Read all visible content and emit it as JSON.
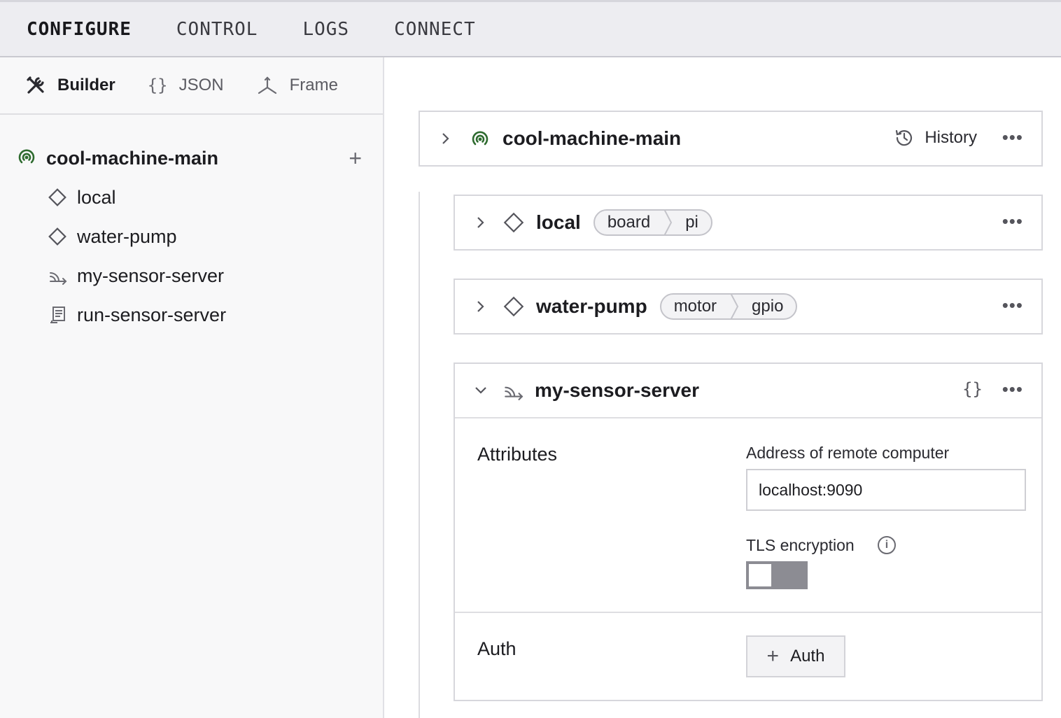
{
  "topnav": {
    "tabs": [
      {
        "label": "CONFIGURE",
        "active": true
      },
      {
        "label": "CONTROL",
        "active": false
      },
      {
        "label": "LOGS",
        "active": false
      },
      {
        "label": "CONNECT",
        "active": false
      }
    ]
  },
  "sidebar": {
    "subtabs": [
      {
        "label": "Builder",
        "icon": "tools-icon",
        "active": true
      },
      {
        "label": "JSON",
        "icon": "braces-icon",
        "active": false
      },
      {
        "label": "Frame",
        "icon": "axes-icon",
        "active": false
      }
    ],
    "tree": {
      "root": {
        "label": "cool-machine-main",
        "icon": "machine-signal-icon",
        "add_label": "+"
      },
      "items": [
        {
          "label": "local",
          "icon": "diamond-icon"
        },
        {
          "label": "water-pump",
          "icon": "diamond-icon"
        },
        {
          "label": "my-sensor-server",
          "icon": "remote-icon"
        },
        {
          "label": "run-sensor-server",
          "icon": "process-icon"
        }
      ]
    }
  },
  "main": {
    "machine_card": {
      "title": "cool-machine-main",
      "history_label": "History",
      "more": "•••"
    },
    "components": [
      {
        "title": "local",
        "type": "board",
        "model": "pi",
        "more": "•••"
      },
      {
        "title": "water-pump",
        "type": "motor",
        "model": "gpio",
        "more": "•••"
      }
    ],
    "remote_card": {
      "title": "my-sensor-server",
      "json_icon": "{}",
      "more": "•••",
      "attributes": {
        "section_title": "Attributes",
        "address_label": "Address of remote computer",
        "address_value": "localhost:9090",
        "tls_label": "TLS encryption",
        "tls_info": "i",
        "tls_enabled": false
      },
      "auth": {
        "section_title": "Auth",
        "button_label": "Auth",
        "button_plus": "+"
      }
    }
  },
  "colors": {
    "online_green": "#2e6b2f",
    "nav_bg": "#ededf1",
    "toggle_off": "#8c8c93"
  }
}
